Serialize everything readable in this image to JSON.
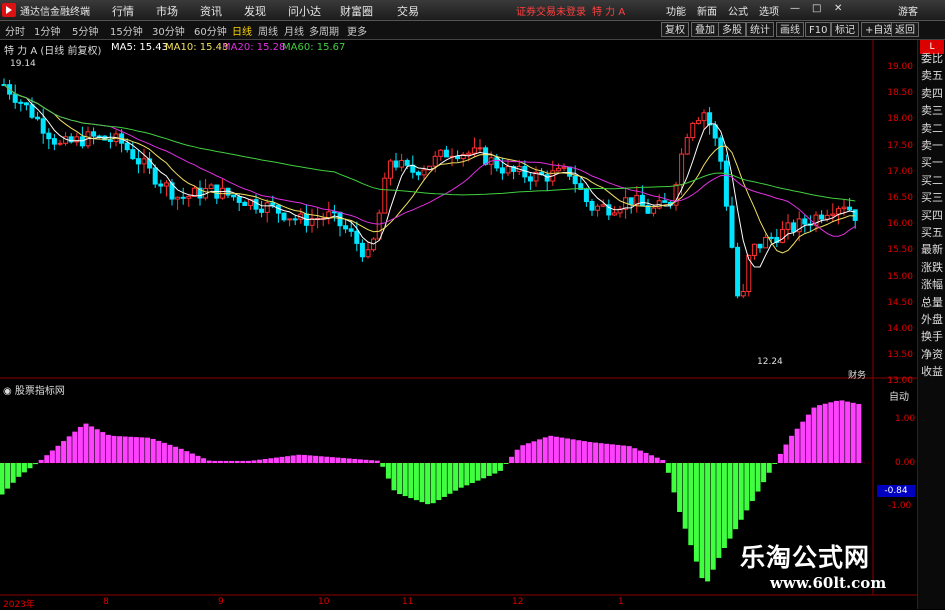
{
  "app": {
    "title": "通达信金融终端",
    "login_status": "证券交易未登录",
    "active_stock": "特 力 A",
    "guest": "游客"
  },
  "menu": [
    "行情",
    "市场",
    "资讯",
    "发现",
    "问小达",
    "财富圈",
    "交易"
  ],
  "window_controls": [
    "功能",
    "新面",
    "公式",
    "选项"
  ],
  "period_tabs": [
    "分时",
    "1分钟",
    "5分钟",
    "15分钟",
    "30分钟",
    "60分钟",
    "日线",
    "周线",
    "月线",
    "多周期",
    "更多"
  ],
  "active_period": "日线",
  "right_buttons": [
    "复权",
    "叠加",
    "多股",
    "统计",
    "画线",
    "F10",
    "标记",
    "+自选",
    "返回"
  ],
  "legend": {
    "name": "特 力 A (日线 前复权)",
    "ma5": "MA5: 15.43",
    "ma10": "MA10: 15.43",
    "ma20": "MA20: 15.28",
    "ma60": "MA60: 15.67"
  },
  "price_axis": [
    "19.00",
    "18.50",
    "18.00",
    "17.50",
    "17.00",
    "16.50",
    "16.00",
    "15.50",
    "15.00",
    "14.50",
    "14.00",
    "13.50",
    "13.00"
  ],
  "annotations": {
    "high": "19.14",
    "low": "12.24",
    "finance": "财务"
  },
  "lower_panel": {
    "title": "股票指标网",
    "auto": "自动",
    "axis": [
      "1.00",
      "0.00",
      "-1.00"
    ],
    "current": "-0.84"
  },
  "dates": [
    "2023年",
    "8",
    "9",
    "10",
    "11",
    "12",
    "1"
  ],
  "sidebar": [
    "委比",
    "卖五",
    "卖四",
    "卖三",
    "卖二",
    "卖一",
    "买一",
    "买二",
    "买三",
    "买四",
    "买五",
    "最新",
    "涨跌",
    "涨幅",
    "总量",
    "外盘",
    "换手",
    "净资",
    "收益"
  ],
  "watermark": {
    "cn": "乐淘公式网",
    "url": "www.60lt.com"
  },
  "colors": {
    "up": "#ff3030",
    "down": "#00e5ff",
    "ma5": "#ffffff",
    "ma10": "#f0e060",
    "ma20": "#e030e0",
    "ma60": "#40d040",
    "hist_pos": "#ff40ff",
    "hist_neg": "#40ff40"
  }
}
